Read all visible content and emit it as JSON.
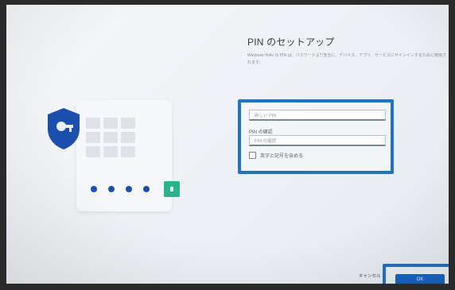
{
  "header": {
    "title": "PIN のセットアップ",
    "description": "Windows Hello の PIN は、パスワードより安全に、デバイス、アプリ、サービスにサインインするために使用されます。"
  },
  "form": {
    "new_pin_placeholder": "新しい PIN",
    "confirm_label": "PIN の確認",
    "confirm_pin_placeholder": "PIN の確認",
    "checkbox_label": "英字と記号を含める"
  },
  "footer": {
    "cancel_label": "キャンセル",
    "ok_label": "OK"
  },
  "colors": {
    "highlight": "#1a73d1",
    "primary_button": "#1566c0",
    "shield": "#1a4fb0",
    "lock": "#2bb38c"
  },
  "icons": {
    "shield": "shield-key-icon",
    "lock": "padlock-icon",
    "checkbox": "checkbox-icon"
  }
}
